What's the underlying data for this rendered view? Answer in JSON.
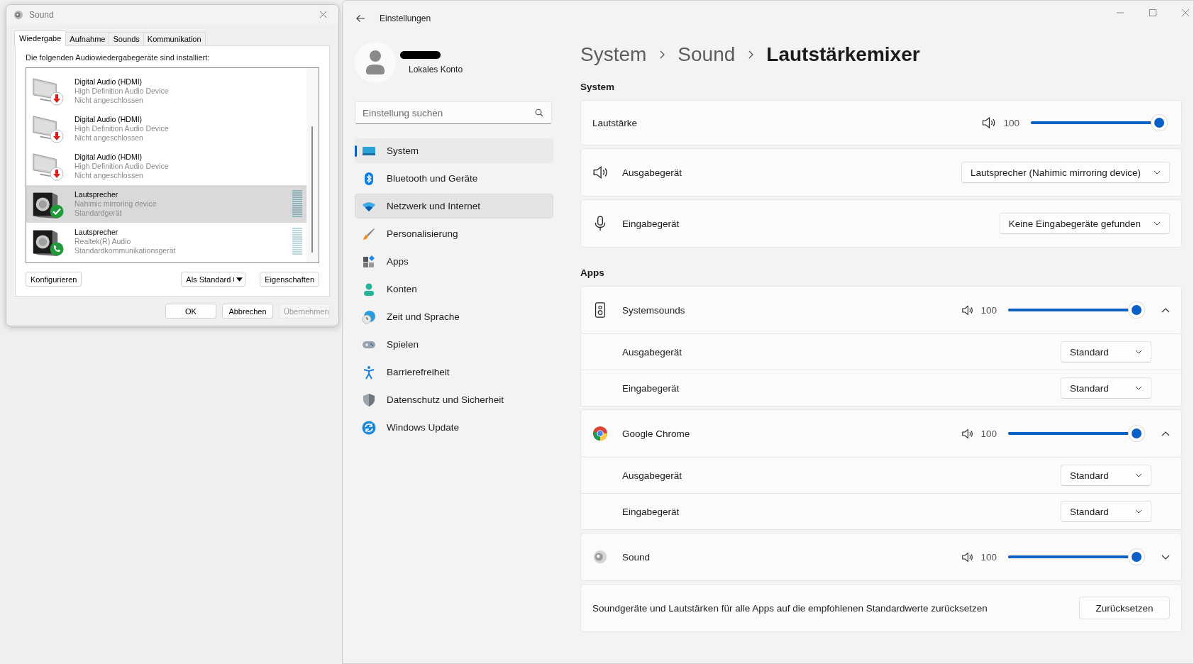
{
  "sound_dialog": {
    "title": "Sound",
    "tabs": [
      {
        "label": "Wiedergabe",
        "selected": true
      },
      {
        "label": "Aufnahme",
        "selected": false
      },
      {
        "label": "Sounds",
        "selected": false
      },
      {
        "label": "Kommunikation",
        "selected": false
      }
    ],
    "intro": "Die folgenden Audiowiedergabegeräte sind installiert:",
    "devices": [
      {
        "kind": "monitor_disconnected",
        "name": "Digital Audio (HDMI)",
        "driver": "High Definition Audio Device",
        "status": "Nicht angeschlossen",
        "selected": false
      },
      {
        "kind": "monitor_disconnected",
        "name": "Digital Audio (HDMI)",
        "driver": "High Definition Audio Device",
        "status": "Nicht angeschlossen",
        "selected": false
      },
      {
        "kind": "monitor_disconnected",
        "name": "Digital Audio (HDMI)",
        "driver": "High Definition Audio Device",
        "status": "Nicht angeschlossen",
        "selected": false
      },
      {
        "kind": "speaker_default",
        "name": "Lautsprecher",
        "driver": "Nahimic mirroring device",
        "status": "Standardgerät",
        "selected": true
      },
      {
        "kind": "speaker_communication",
        "name": "Lautsprecher",
        "driver": "Realtek(R) Audio",
        "status": "Standardkommunikationsgerät",
        "selected": false
      }
    ],
    "list_buttons": [
      {
        "label": "Konfigurieren",
        "kind": "plain"
      },
      {
        "label": "Als Standard",
        "kind": "split"
      },
      {
        "label": "Eigenschaften",
        "kind": "plain"
      }
    ],
    "buttons": [
      {
        "label": "OK",
        "disabled": false
      },
      {
        "label": "Abbrechen",
        "disabled": false
      },
      {
        "label": "Übernehmen",
        "disabled": true
      }
    ]
  },
  "settings": {
    "title": "Einstellungen",
    "account": {
      "type": "Lokales Konto"
    },
    "search": {
      "placeholder": "Einstellung suchen"
    },
    "nav": [
      {
        "label": "System",
        "kind": "system",
        "selected": true,
        "hovered": false
      },
      {
        "label": "Bluetooth und Geräte",
        "kind": "bluetooth",
        "selected": false,
        "hovered": false
      },
      {
        "label": "Netzwerk und Internet",
        "kind": "network",
        "selected": false,
        "hovered": true
      },
      {
        "label": "Personalisierung",
        "kind": "brush",
        "selected": false,
        "hovered": false
      },
      {
        "label": "Apps",
        "kind": "apps",
        "selected": false,
        "hovered": false
      },
      {
        "label": "Konten",
        "kind": "person",
        "selected": false,
        "hovered": false
      },
      {
        "label": "Zeit und Sprache",
        "kind": "time",
        "selected": false,
        "hovered": false
      },
      {
        "label": "Spielen",
        "kind": "gaming",
        "selected": false,
        "hovered": false
      },
      {
        "label": "Barrierefreiheit",
        "kind": "accessibility",
        "selected": false,
        "hovered": false
      },
      {
        "label": "Datenschutz und Sicherheit",
        "kind": "shield",
        "selected": false,
        "hovered": false
      },
      {
        "label": "Windows Update",
        "kind": "update",
        "selected": false,
        "hovered": false
      }
    ],
    "breadcrumb": [
      "System",
      "Sound",
      "Lautstärkemixer"
    ],
    "system_section": {
      "heading": "System",
      "volume": {
        "label": "Lautstärke",
        "reading": "100",
        "level": 1
      },
      "devices": [
        {
          "kind": "output",
          "label": "Ausgabegerät",
          "value": "Lautsprecher (Nahimic mirroring device)"
        },
        {
          "kind": "input",
          "label": "Eingabegerät",
          "value": "Keine Eingabegeräte gefunden"
        }
      ]
    },
    "apps_section": {
      "heading": "Apps",
      "apps": [
        {
          "kind": "speaker",
          "name": "Systemsounds",
          "reading": "100",
          "level": 1,
          "expanded": true,
          "rows": [
            {
              "label": "Ausgabegerät",
              "value": "Standard"
            },
            {
              "label": "Eingabegerät",
              "value": "Standard"
            }
          ]
        },
        {
          "kind": "chrome",
          "name": "Google Chrome",
          "reading": "100",
          "level": 1,
          "expanded": true,
          "rows": [
            {
              "label": "Ausgabegerät",
              "value": "Standard"
            },
            {
              "label": "Eingabegerät",
              "value": "Standard"
            }
          ]
        },
        {
          "kind": "sound",
          "name": "Sound",
          "reading": "100",
          "level": 1,
          "expanded": false
        }
      ]
    },
    "reset": {
      "text": "Soundgeräte und Lautstärken für alle Apps auf die empfohlenen Standardwerte zurücksetzen",
      "button": "Zurücksetzen"
    }
  }
}
